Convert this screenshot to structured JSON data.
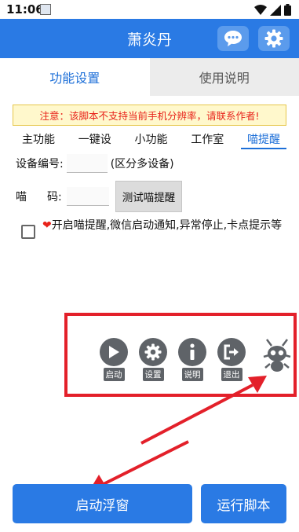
{
  "status_bar": {
    "time": "11:06"
  },
  "header": {
    "title": "萧炎丹",
    "chat_icon": "chat-bubble-icon",
    "settings_icon": "gear-icon"
  },
  "tabs": {
    "settings": "功能设置",
    "help": "使用说明"
  },
  "notice": "注意：该脚本不支持当前手机分辨率，请联系作者!",
  "sub_tabs": [
    "主功能",
    "一键设",
    "小功能",
    "工作室",
    "喵提醒"
  ],
  "form": {
    "device_label": "设备编号:",
    "device_value": "",
    "device_hint": "(区分多设备)",
    "code_label_1": "喵",
    "code_label_2": "码:",
    "code_value": "",
    "test_button": "测试喵提醒",
    "heart": "❤",
    "reminder_label": "开启喵提醒,微信启动通知,异常停止,卡点提示等",
    "reminder_checked": false
  },
  "floating_menu": {
    "items": [
      {
        "label": "启动",
        "icon": "play-icon"
      },
      {
        "label": "设置",
        "icon": "gear-icon"
      },
      {
        "label": "说明",
        "icon": "info-icon"
      },
      {
        "label": "退出",
        "icon": "exit-icon"
      }
    ],
    "mascot_icon": "bug-robot-icon"
  },
  "buttons": {
    "start_float": "启动浮窗",
    "run_script": "运行脚本"
  },
  "colors": {
    "primary": "#2a7ae4",
    "annotation_red": "#e3202a",
    "notice_text": "#e8231b"
  }
}
